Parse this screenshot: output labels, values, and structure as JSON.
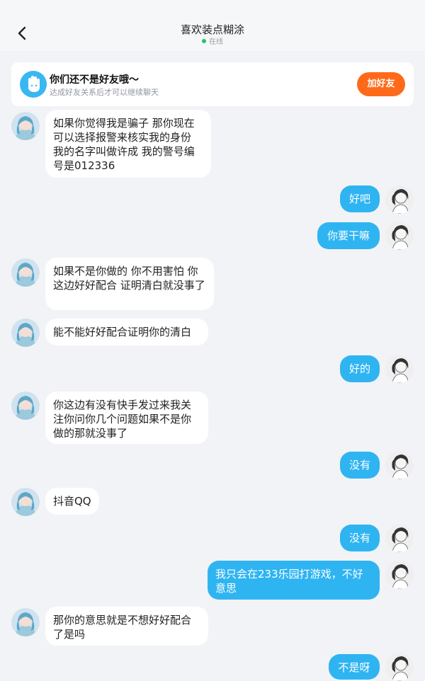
{
  "header": {
    "title": "喜欢装点糊涂",
    "status": "在线"
  },
  "friend_card": {
    "title": "你们还不是好友哦～",
    "subtitle": "达成好友关系后才可以继续聊天",
    "button": "加好友"
  },
  "messages": [
    {
      "side": "left",
      "text": "如果你觉得我是骗子 那你现在可以选择报警来核实我的身份 我的名字叫做许成 我的警号编号是012336"
    },
    {
      "side": "right",
      "text": "好吧"
    },
    {
      "side": "right",
      "text": "你要干嘛"
    },
    {
      "side": "left",
      "text": "如果不是你做的 你不用害怕 你这边好好配合 证明清白就没事了"
    },
    {
      "side": "left",
      "text": "能不能好好配合证明你的清白"
    },
    {
      "side": "right",
      "text": "好的"
    },
    {
      "side": "left",
      "text": "你这边有没有快手发过来我关注你问你几个问题如果不是你做的那就没事了"
    },
    {
      "side": "right",
      "text": "没有"
    },
    {
      "side": "left",
      "text": "抖音QQ"
    },
    {
      "side": "right",
      "text": "没有"
    },
    {
      "side": "right",
      "text": "我只会在233乐园打游戏，不好意思"
    },
    {
      "side": "left",
      "text": "那你的意思就是不想好好配合了是吗"
    },
    {
      "side": "right",
      "text": "不是呀"
    }
  ],
  "colors": {
    "accent": "#2fb4f2",
    "button": "#ff6a1a",
    "online": "#22c55e"
  }
}
